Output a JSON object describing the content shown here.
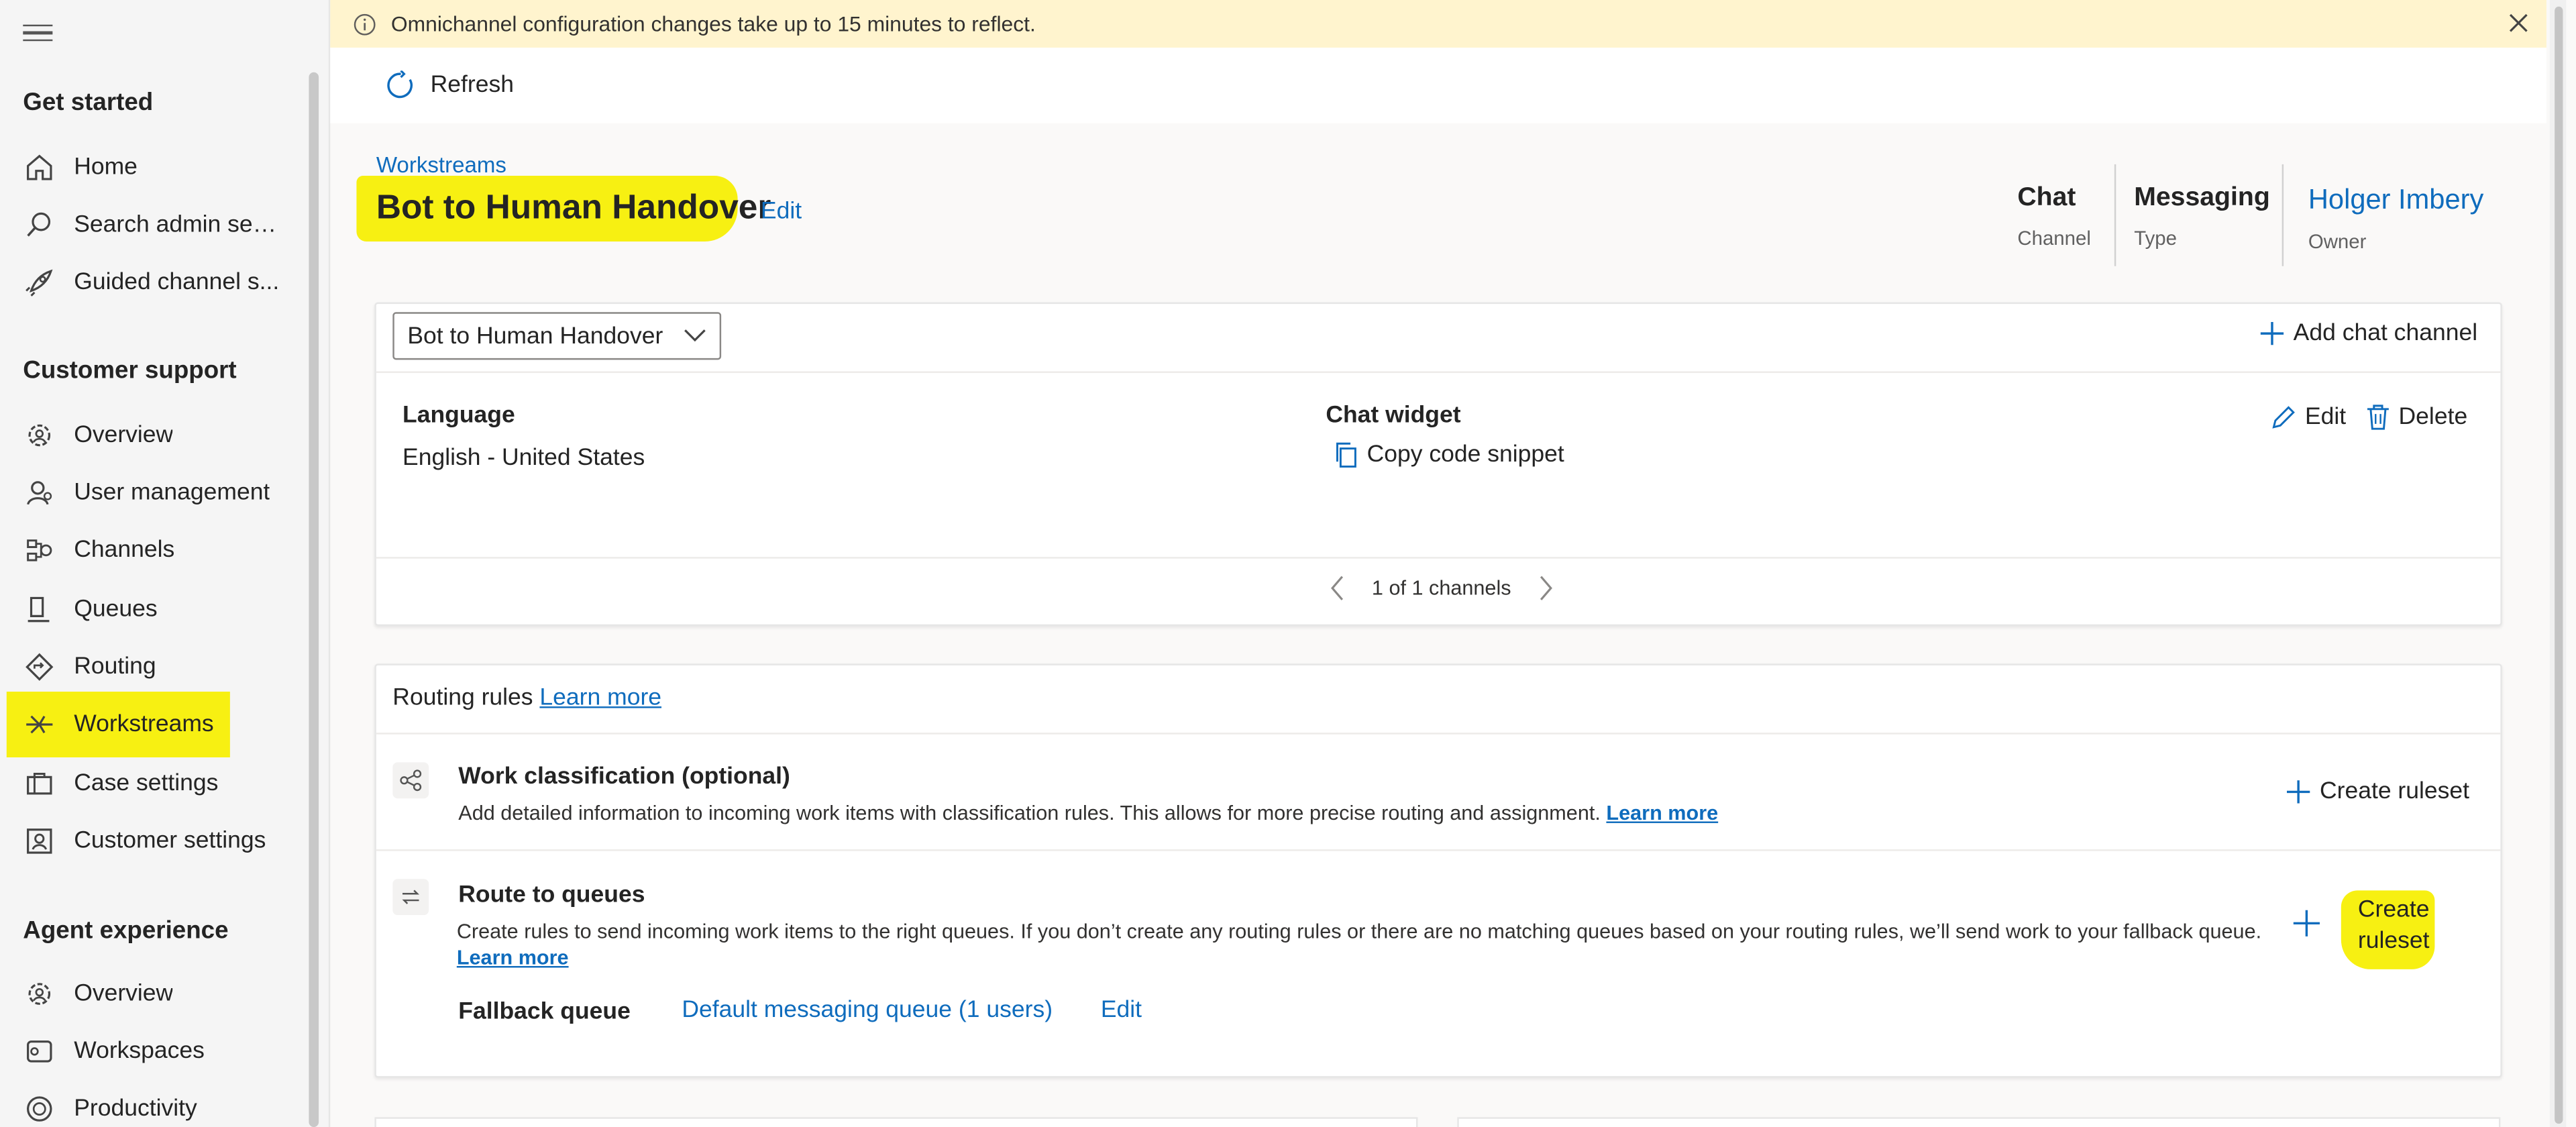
{
  "banner": {
    "text": "Omnichannel configuration changes take up to 15 minutes to reflect."
  },
  "toolbar": {
    "refresh_label": "Refresh"
  },
  "sidebar": {
    "sections": [
      {
        "title": "Get started",
        "items": [
          {
            "label": "Home",
            "icon": "home-icon"
          },
          {
            "label": "Search admin sett...",
            "icon": "search-icon"
          },
          {
            "label": "Guided channel s...",
            "icon": "rocket-icon"
          }
        ]
      },
      {
        "title": "Customer support",
        "items": [
          {
            "label": "Overview",
            "icon": "gear-people-icon"
          },
          {
            "label": "User management",
            "icon": "person-icon"
          },
          {
            "label": "Channels",
            "icon": "channels-icon"
          },
          {
            "label": "Queues",
            "icon": "queue-icon"
          },
          {
            "label": "Routing",
            "icon": "routing-icon"
          },
          {
            "label": "Workstreams",
            "icon": "workstream-icon",
            "active": true
          },
          {
            "label": "Case settings",
            "icon": "case-icon"
          },
          {
            "label": "Customer settings",
            "icon": "contact-icon"
          }
        ]
      },
      {
        "title": "Agent experience",
        "items": [
          {
            "label": "Overview",
            "icon": "gear-people-icon"
          },
          {
            "label": "Workspaces",
            "icon": "workspace-icon"
          },
          {
            "label": "Productivity",
            "icon": "productivity-icon"
          }
        ]
      }
    ]
  },
  "header": {
    "breadcrumb": "Workstreams",
    "title": "Bot to Human Handover",
    "edit_label": "Edit",
    "meta": [
      {
        "value": "Chat",
        "caption": "Channel"
      },
      {
        "value": "Messaging",
        "caption": "Type"
      },
      {
        "value": "Holger Imbery",
        "caption": "Owner"
      }
    ]
  },
  "channel_card": {
    "selected_channel": "Bot to Human Handover",
    "add_label": "Add chat channel",
    "language_label": "Language",
    "language_value": "English - United States",
    "widget_label": "Chat widget",
    "copy_label": "Copy code snippet",
    "edit_label": "Edit",
    "delete_label": "Delete",
    "pager_text": "1 of 1 channels"
  },
  "routing": {
    "heading": "Routing rules",
    "learn_more": "Learn more",
    "work_classification": {
      "title": "Work classification (optional)",
      "description": "Add detailed information to incoming work items with classification rules. This allows for more precise routing and assignment.",
      "learn_more": "Learn more",
      "create_label": "Create ruleset"
    },
    "route_to_queues": {
      "title": "Route to queues",
      "description": "Create rules to send incoming work items to the right queues. If you don’t create any routing rules or there are no matching queues based on your routing rules, we’ll send work to your fallback queue.",
      "learn_more": "Learn more",
      "create_label": "Create ruleset",
      "fallback_label": "Fallback queue",
      "fallback_value": "Default messaging queue (1 users)",
      "fallback_edit": "Edit"
    }
  }
}
